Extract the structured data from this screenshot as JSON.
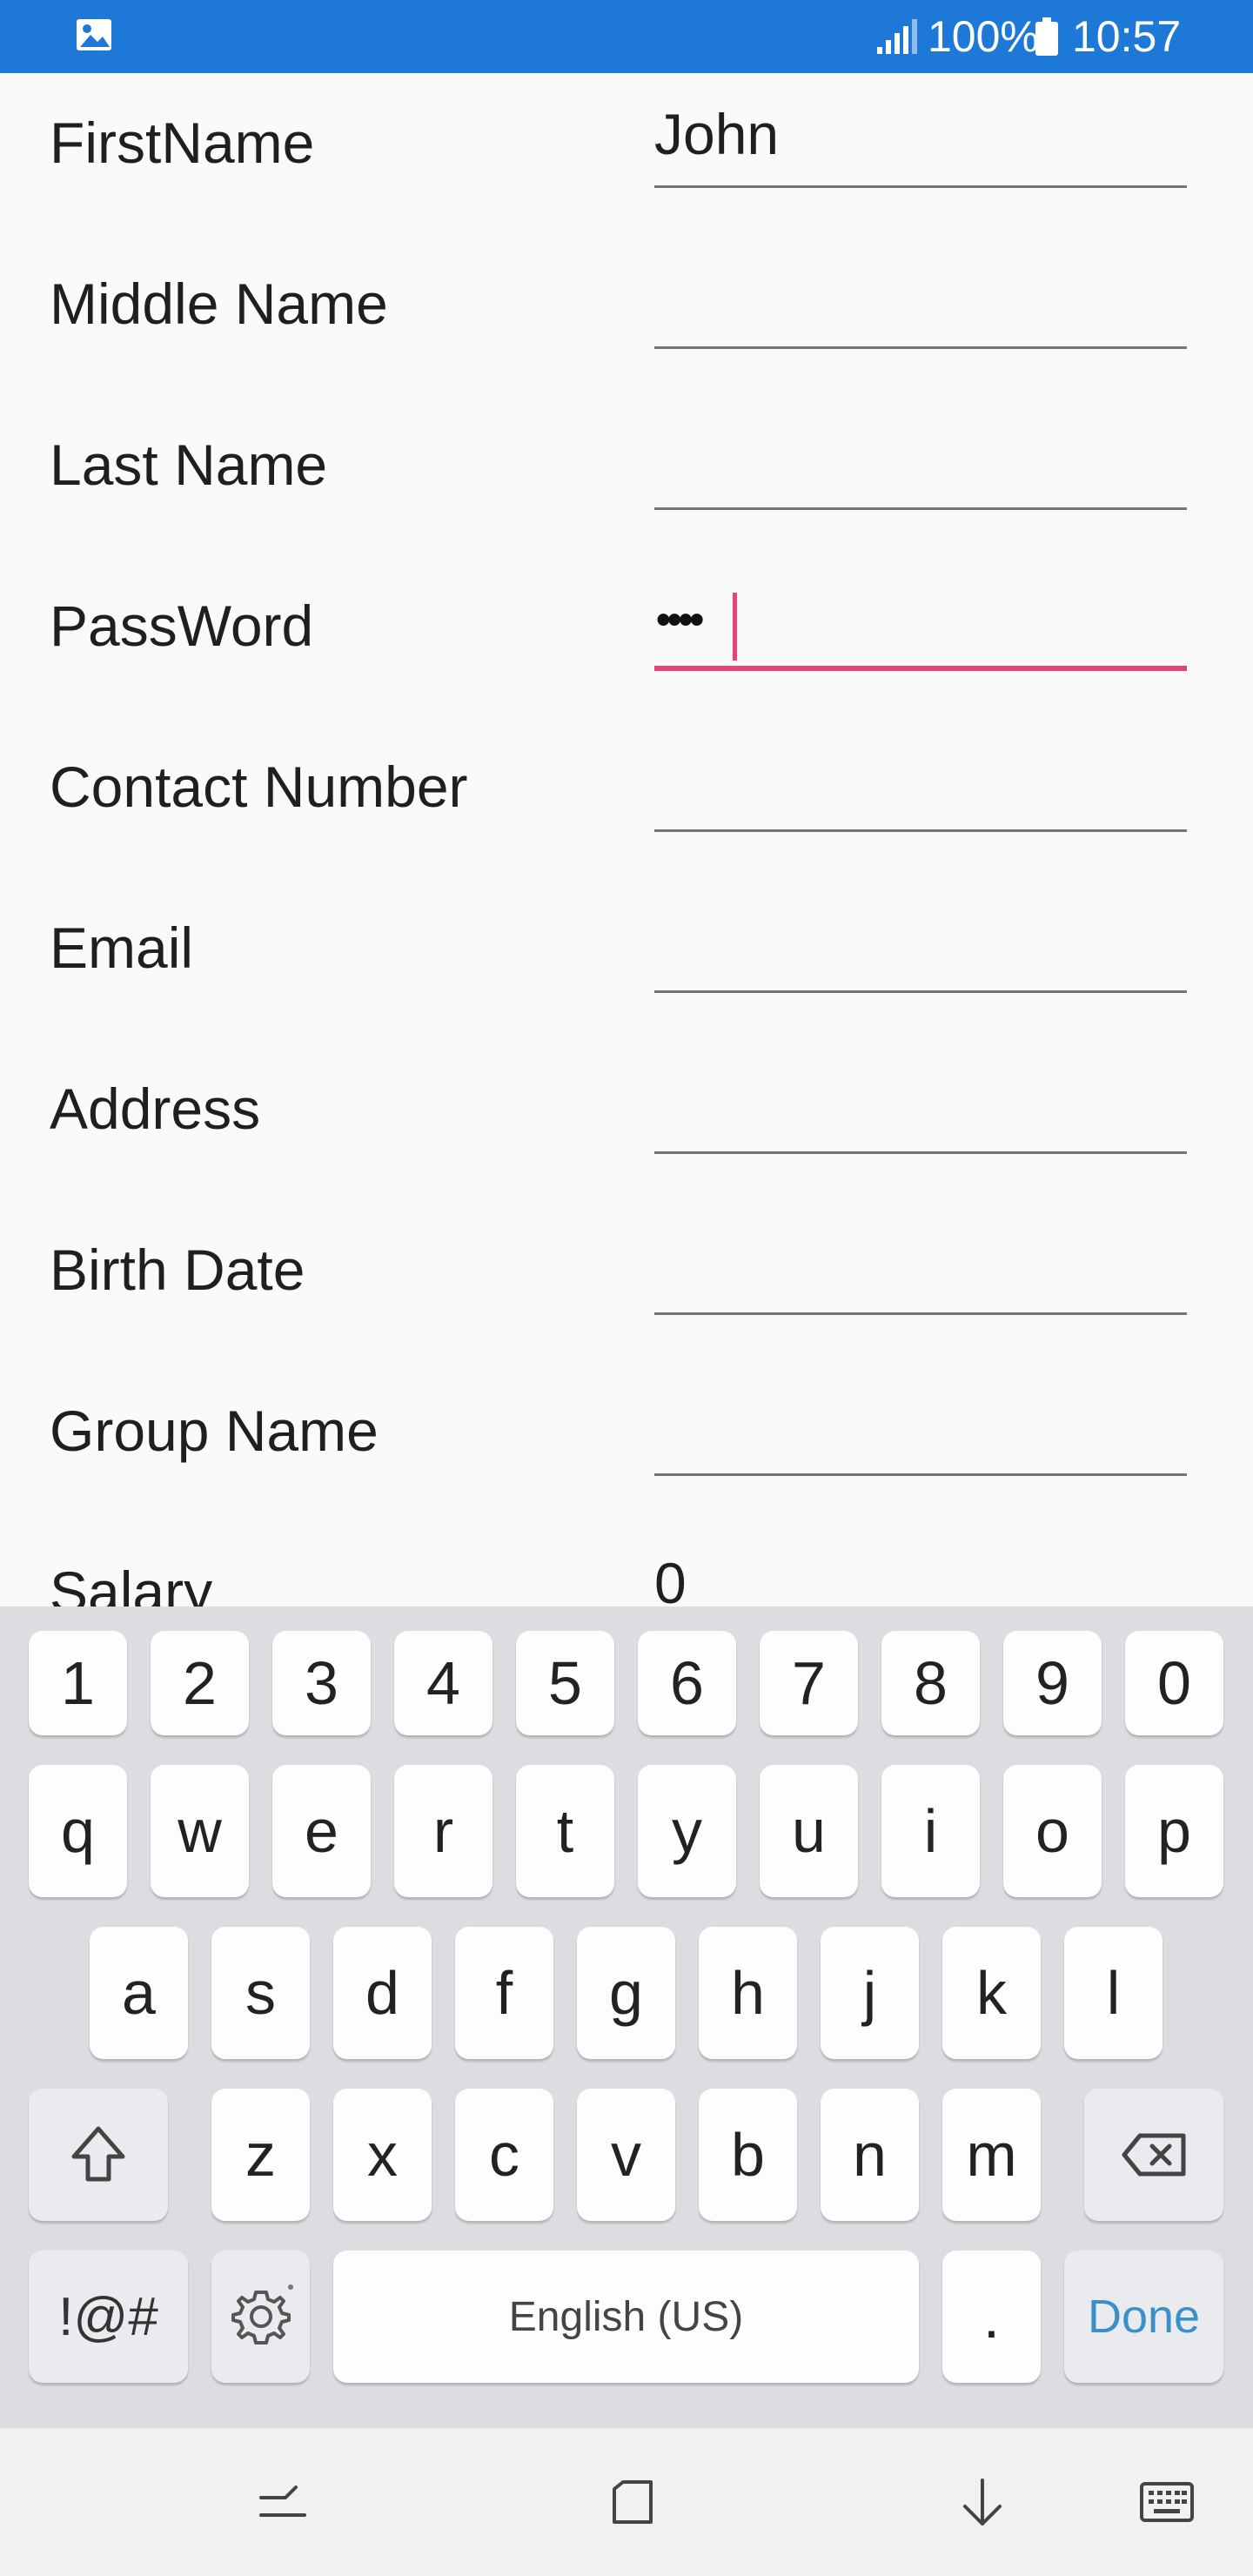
{
  "status_bar": {
    "battery_percent": "100%",
    "time": "10:57",
    "icons": [
      "gallery-icon",
      "signal-icon",
      "battery-icon"
    ]
  },
  "form": {
    "fields": [
      {
        "label": "FirstName",
        "value": ""
      },
      {
        "label": "Middle Name",
        "value": ""
      },
      {
        "label": "Last Name",
        "value": ""
      },
      {
        "label": "PassWord",
        "value": "••••"
      },
      {
        "label": "Contact Number",
        "value": ""
      },
      {
        "label": "Email",
        "value": ""
      },
      {
        "label": "Address",
        "value": ""
      },
      {
        "label": "Birth Date",
        "value": ""
      },
      {
        "label": "Group Name",
        "value": ""
      },
      {
        "label": "Salary",
        "value": "0"
      }
    ],
    "first_name_value": "John",
    "focused_field": "PassWord",
    "accent_color": "#e8417c"
  },
  "keyboard": {
    "number_row": [
      "1",
      "2",
      "3",
      "4",
      "5",
      "6",
      "7",
      "8",
      "9",
      "0"
    ],
    "row1": [
      "q",
      "w",
      "e",
      "r",
      "t",
      "y",
      "u",
      "i",
      "o",
      "p"
    ],
    "row2": [
      "a",
      "s",
      "d",
      "f",
      "g",
      "h",
      "j",
      "k",
      "l"
    ],
    "row3": [
      "z",
      "x",
      "c",
      "v",
      "b",
      "n",
      "m"
    ],
    "symbols_label": "!@#",
    "space_label": "English (US)",
    "period_label": ".",
    "done_label": "Done"
  },
  "nav_bar": {
    "icons": [
      "recent-apps-icon",
      "home-icon",
      "hide-keyboard-icon",
      "keyboard-switch-icon"
    ]
  }
}
